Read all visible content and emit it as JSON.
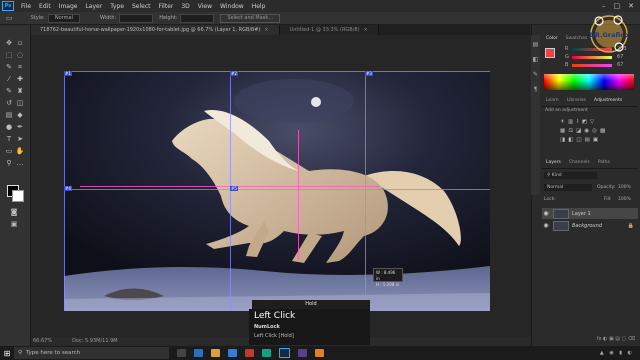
{
  "app": {
    "menu": [
      "File",
      "Edit",
      "Image",
      "Layer",
      "Type",
      "Select",
      "Filter",
      "3D",
      "View",
      "Window",
      "Help"
    ],
    "logo_text": "Ps",
    "window_controls": [
      "–",
      "□",
      "✕"
    ]
  },
  "options_bar": {
    "style_label": "Style:",
    "style_value": "Normal",
    "width_label": "Width:",
    "height_label": "Height:",
    "select_mask": "Select and Mask..."
  },
  "tabs": [
    {
      "label": "718762-beautiful-horse-wallpaper-1920x1080-for-tablet.jpg @ 66.7% (Layer 1, RGB/8#)",
      "active": true
    },
    {
      "label": "Untitled-1 @ 33.3% (RGB/8)",
      "active": false
    }
  ],
  "canvas": {
    "guide_labels": [
      "#1",
      "#2",
      "#3",
      "#4",
      "#5"
    ],
    "measure_w": "W : 8.496 in",
    "measure_h": "H : 5.208 in"
  },
  "status": {
    "zoom": "66.67%",
    "doc": "Doc: 5.93M/11.9M"
  },
  "color_panel": {
    "tabs": [
      "Color",
      "Swatches"
    ],
    "r_label": "R",
    "r_value": "233",
    "g_label": "G",
    "g_value": "67",
    "b_label": "B",
    "b_value": "67"
  },
  "adjust_panel": {
    "tabs": [
      "Learn",
      "Libraries",
      "Adjustments"
    ],
    "add_label": "Add an adjustment"
  },
  "layers_panel": {
    "tabs": [
      "Layers",
      "Channels",
      "Paths"
    ],
    "kind": "Kind",
    "blend": "Normal",
    "opacity_label": "Opacity:",
    "opacity_value": "100%",
    "lock_label": "Lock:",
    "fill_label": "Fill:",
    "fill_value": "100%",
    "layers": [
      {
        "name": "Layer 1"
      },
      {
        "name": "Background"
      }
    ],
    "footer_icons": "fx ◐ ▣ ▤ ▢ ⌫"
  },
  "hint": {
    "hold": "Hold",
    "title": "Left Click",
    "sub": "NumLock",
    "detail": "Left Click [Hold]"
  },
  "taskbar": {
    "search_placeholder": "Type here to search"
  },
  "watermark": {
    "text": "DR.Grafico"
  },
  "colors": {
    "accent": "#31a8ff",
    "guide": "#8c8cff",
    "selection_label": "#3b4bd0"
  }
}
